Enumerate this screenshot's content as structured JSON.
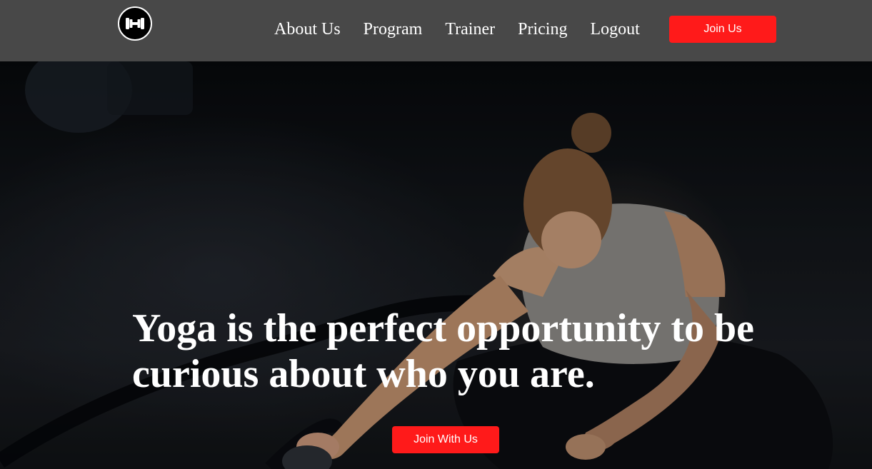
{
  "header": {
    "logo_icon": "dumbbell-icon",
    "nav": [
      {
        "label": "About Us"
      },
      {
        "label": "Program"
      },
      {
        "label": "Trainer"
      },
      {
        "label": "Pricing"
      },
      {
        "label": "Logout"
      }
    ],
    "join_label": "Join Us"
  },
  "hero": {
    "title": "Yoga is the perfect opportunity to be curious about who you are.",
    "cta_label": "Join With Us",
    "background_image": "athlete-stretching-photo"
  },
  "colors": {
    "nav_background": "#484848",
    "accent": "#ff1a1a",
    "text": "#ffffff"
  }
}
